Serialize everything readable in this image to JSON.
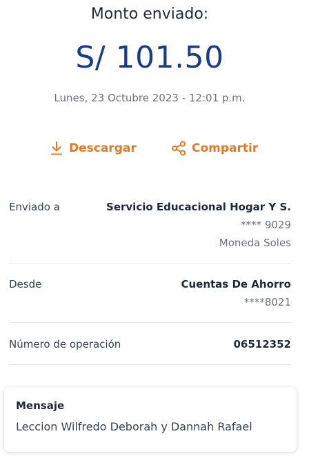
{
  "header": {
    "title": "Monto enviado:",
    "amount": "S/ 101.50",
    "date": "Lunes, 23 Octubre 2023 - 12:01 p.m."
  },
  "actions": {
    "download_label": "Descargar",
    "share_label": "Compartir",
    "accent_color": "#e87722"
  },
  "details": {
    "sent_to": {
      "label": "Enviado a",
      "name": "Servicio Educacional Hogar Y S.",
      "account": "**** 9029",
      "currency": "Moneda Soles"
    },
    "from": {
      "label": "Desde",
      "name": "Cuentas De Ahorro",
      "account": "****8021"
    },
    "operation": {
      "label": "Número de operación",
      "number": "06512352"
    }
  },
  "message": {
    "title": "Mensaje",
    "body": "Leccion Wilfredo Deborah y Dannah Rafael"
  },
  "colors": {
    "amount": "#1a3a8a",
    "accent": "#e87722"
  }
}
